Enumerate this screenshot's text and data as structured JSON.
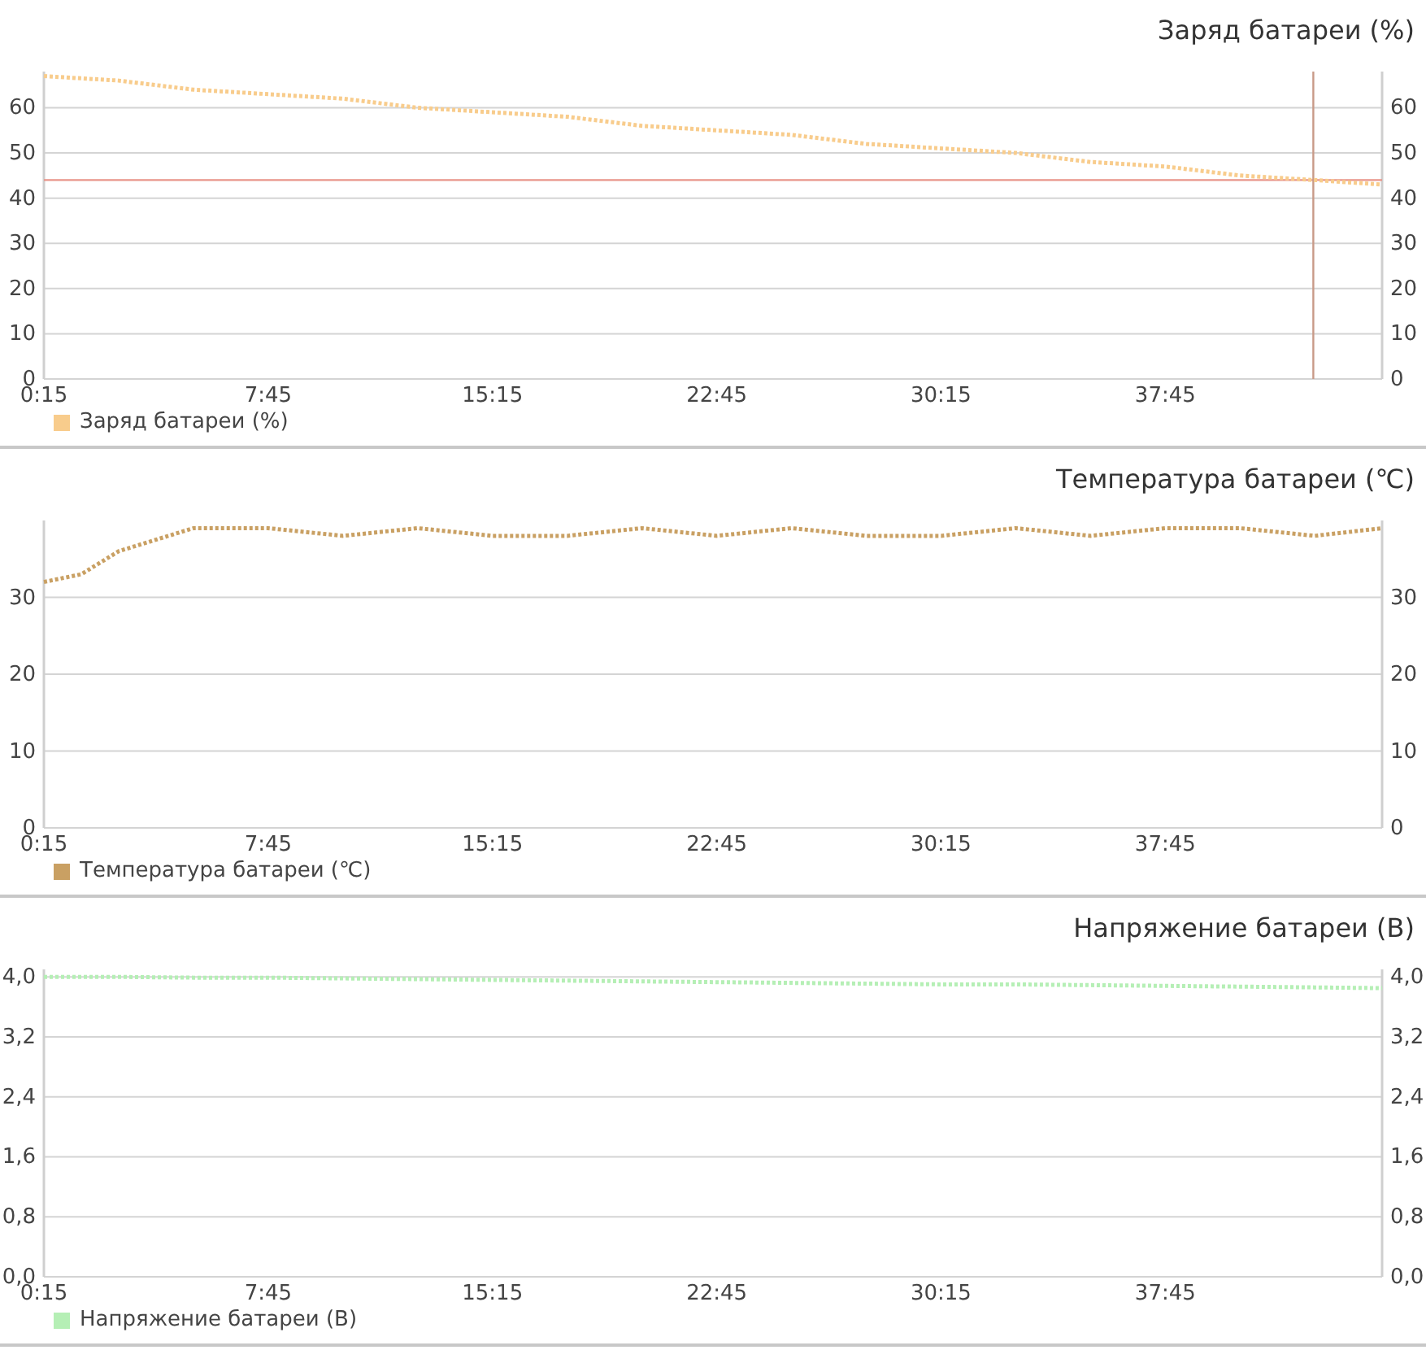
{
  "charts": [
    {
      "chart_data": {
        "type": "line",
        "title": "Заряд батареи (%)",
        "x": [
          0.25,
          2.75,
          5.25,
          7.75,
          10.25,
          12.75,
          15.25,
          17.75,
          20.25,
          22.75,
          25.25,
          27.75,
          30.25,
          32.75,
          35.25,
          37.75,
          40.25,
          42.75,
          45
        ],
        "series": [
          {
            "name": "Заряд батареи (%)",
            "color": "#f8cc8c",
            "line_style": "dotted",
            "values": [
              67,
              66,
              64,
              63,
              62,
              60,
              59,
              58,
              56,
              55,
              54,
              52,
              51,
              50,
              48,
              47,
              45,
              44,
              43
            ]
          }
        ],
        "xlim": [
          0.25,
          45
        ],
        "ylim": [
          0,
          68
        ],
        "grid": true,
        "xticks": [
          {
            "value": 0.25,
            "label": "0:15"
          },
          {
            "value": 7.75,
            "label": "7:45"
          },
          {
            "value": 15.25,
            "label": "15:15"
          },
          {
            "value": 22.75,
            "label": "22:45"
          },
          {
            "value": 30.25,
            "label": "30:15"
          },
          {
            "value": 37.75,
            "label": "37:45"
          }
        ],
        "yticks": [
          {
            "value": 0,
            "label": "0"
          },
          {
            "value": 10,
            "label": "10"
          },
          {
            "value": 20,
            "label": "20"
          },
          {
            "value": 30,
            "label": "30"
          },
          {
            "value": 40,
            "label": "40"
          },
          {
            "value": 50,
            "label": "50"
          },
          {
            "value": 60,
            "label": "60"
          }
        ],
        "ref_lines": [
          {
            "axis": "y",
            "value": 44
          },
          {
            "axis": "x",
            "value": 42.7
          }
        ]
      }
    },
    {
      "chart_data": {
        "type": "line",
        "title": "Температура батареи (℃)",
        "x": [
          0.25,
          1.5,
          2.75,
          5.25,
          7.75,
          10.25,
          12.75,
          15.25,
          17.75,
          20.25,
          22.75,
          25.25,
          27.75,
          30.25,
          32.75,
          35.25,
          37.75,
          40.25,
          42.75,
          45
        ],
        "series": [
          {
            "name": "Температура батареи (℃)",
            "color": "#c9a063",
            "line_style": "dotted",
            "values": [
              32,
              33,
              36,
              39,
              39,
              38,
              39,
              38,
              38,
              39,
              38,
              39,
              38,
              38,
              39,
              38,
              39,
              39,
              38,
              39
            ]
          }
        ],
        "xlim": [
          0.25,
          45
        ],
        "ylim": [
          0,
          40
        ],
        "grid": true,
        "xticks": [
          {
            "value": 0.25,
            "label": "0:15"
          },
          {
            "value": 7.75,
            "label": "7:45"
          },
          {
            "value": 15.25,
            "label": "15:15"
          },
          {
            "value": 22.75,
            "label": "22:45"
          },
          {
            "value": 30.25,
            "label": "30:15"
          },
          {
            "value": 37.75,
            "label": "37:45"
          }
        ],
        "yticks": [
          {
            "value": 0,
            "label": "0"
          },
          {
            "value": 10,
            "label": "10"
          },
          {
            "value": 20,
            "label": "20"
          },
          {
            "value": 30,
            "label": "30"
          }
        ]
      }
    },
    {
      "chart_data": {
        "type": "line",
        "title": "Напряжение батареи (В)",
        "x": [
          0.25,
          2.75,
          5.25,
          7.75,
          10.25,
          12.75,
          15.25,
          17.75,
          20.25,
          22.75,
          25.25,
          27.75,
          30.25,
          32.75,
          35.25,
          37.75,
          40.25,
          42.75,
          45
        ],
        "series": [
          {
            "name": "Напряжение батареи (В)",
            "color": "#b5efb5",
            "line_style": "dotted",
            "values": [
              4.0,
              4.0,
              3.99,
              3.99,
              3.98,
              3.97,
              3.96,
              3.95,
              3.94,
              3.93,
              3.92,
              3.91,
              3.9,
              3.9,
              3.89,
              3.88,
              3.87,
              3.86,
              3.85
            ]
          }
        ],
        "xlim": [
          0.25,
          45
        ],
        "ylim": [
          0,
          4.1
        ],
        "grid": true,
        "xticks": [
          {
            "value": 0.25,
            "label": "0:15"
          },
          {
            "value": 7.75,
            "label": "7:45"
          },
          {
            "value": 15.25,
            "label": "15:15"
          },
          {
            "value": 22.75,
            "label": "22:45"
          },
          {
            "value": 30.25,
            "label": "30:15"
          },
          {
            "value": 37.75,
            "label": "37:45"
          }
        ],
        "yticks": [
          {
            "value": 0,
            "label": "0,0"
          },
          {
            "value": 0.8,
            "label": "0,8"
          },
          {
            "value": 1.6,
            "label": "1,6"
          },
          {
            "value": 2.4,
            "label": "2,4"
          },
          {
            "value": 3.2,
            "label": "3,2"
          },
          {
            "value": 4.0,
            "label": "4,0"
          }
        ]
      }
    }
  ]
}
